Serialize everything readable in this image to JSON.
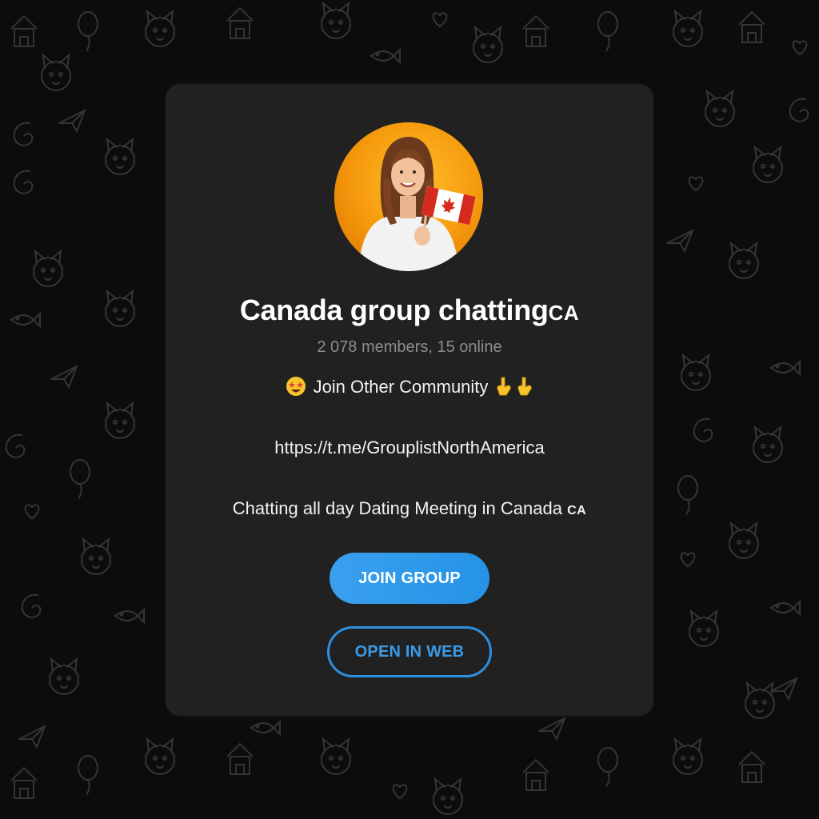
{
  "group": {
    "name": "Canada group chatting",
    "name_suffix": "CA",
    "members_text": "2 078 members, 15 online"
  },
  "description": {
    "line1_emoji": "star-struck-emoji",
    "line1_text": "Join Other Community",
    "line1_trailing_emoji": "pointing-down-hands",
    "line2_link": "https://t.me/GrouplistNorthAmerica",
    "line3_text": "Chatting all day Dating Meeting in Canada",
    "line3_suffix": "CA"
  },
  "buttons": {
    "join_label": "JOIN GROUP",
    "web_label": "OPEN IN WEB"
  },
  "colors": {
    "background": "#0c0c0c",
    "card": "#212121",
    "accent": "#2d8fe0",
    "avatar_bg": "#f59a0c"
  }
}
